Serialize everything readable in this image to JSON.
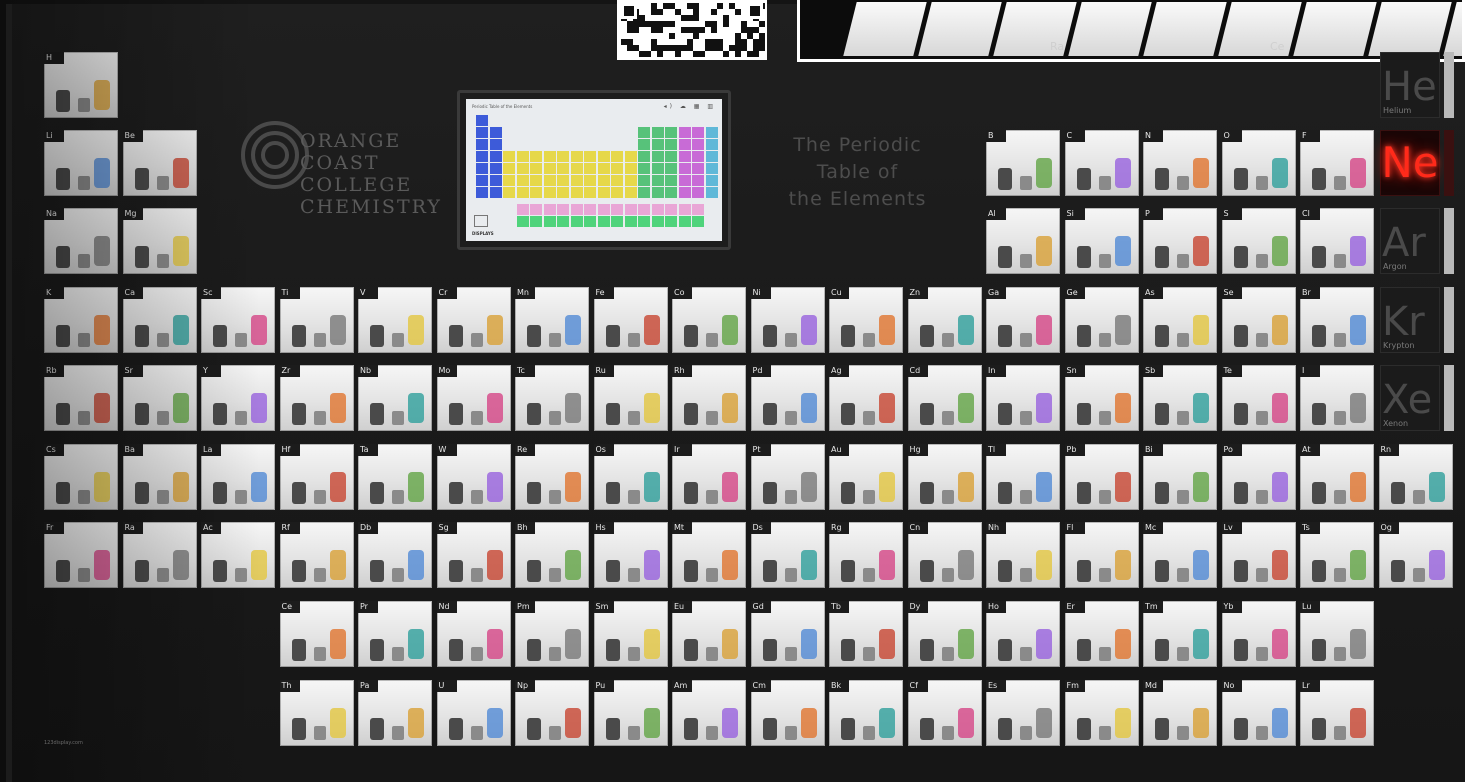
{
  "scene": {
    "college_name": [
      "ORANGE",
      "COAST",
      "COLLEGE",
      "CHEMISTRY"
    ],
    "title": [
      "The Periodic",
      "Table of",
      "the Elements"
    ],
    "monitor_title": "Periodic Table of the Elements",
    "monitor_icons": "◂) ☁ ▦ ▥",
    "monitor_footer": "DISPLAYS",
    "neon": "Ne",
    "watermark": "123display.com"
  },
  "noble_gases": [
    {
      "symbol": "He",
      "name": "Helium"
    },
    {
      "symbol": "Ar",
      "name": "Argon"
    },
    {
      "symbol": "Kr",
      "name": "Krypton"
    },
    {
      "symbol": "Xe",
      "name": "Xenon"
    }
  ],
  "inset_labels": [
    "Ra",
    "Ce"
  ],
  "elements": [
    {
      "s": "H",
      "r": 0,
      "c": 0
    },
    {
      "s": "Li",
      "r": 1,
      "c": 0
    },
    {
      "s": "Be",
      "r": 1,
      "c": 1
    },
    {
      "s": "B",
      "r": 1,
      "c": 12
    },
    {
      "s": "C",
      "r": 1,
      "c": 13
    },
    {
      "s": "N",
      "r": 1,
      "c": 14
    },
    {
      "s": "O",
      "r": 1,
      "c": 15
    },
    {
      "s": "F",
      "r": 1,
      "c": 16
    },
    {
      "s": "Na",
      "r": 2,
      "c": 0
    },
    {
      "s": "Mg",
      "r": 2,
      "c": 1
    },
    {
      "s": "Al",
      "r": 2,
      "c": 12
    },
    {
      "s": "Si",
      "r": 2,
      "c": 13
    },
    {
      "s": "P",
      "r": 2,
      "c": 14
    },
    {
      "s": "S",
      "r": 2,
      "c": 15
    },
    {
      "s": "Cl",
      "r": 2,
      "c": 16
    },
    {
      "s": "K",
      "r": 3,
      "c": 0
    },
    {
      "s": "Ca",
      "r": 3,
      "c": 1
    },
    {
      "s": "Sc",
      "r": 3,
      "c": 2
    },
    {
      "s": "Ti",
      "r": 3,
      "c": 3
    },
    {
      "s": "V",
      "r": 3,
      "c": 4
    },
    {
      "s": "Cr",
      "r": 3,
      "c": 5
    },
    {
      "s": "Mn",
      "r": 3,
      "c": 6
    },
    {
      "s": "Fe",
      "r": 3,
      "c": 7
    },
    {
      "s": "Co",
      "r": 3,
      "c": 8
    },
    {
      "s": "Ni",
      "r": 3,
      "c": 9
    },
    {
      "s": "Cu",
      "r": 3,
      "c": 10
    },
    {
      "s": "Zn",
      "r": 3,
      "c": 11
    },
    {
      "s": "Ga",
      "r": 3,
      "c": 12
    },
    {
      "s": "Ge",
      "r": 3,
      "c": 13
    },
    {
      "s": "As",
      "r": 3,
      "c": 14
    },
    {
      "s": "Se",
      "r": 3,
      "c": 15
    },
    {
      "s": "Br",
      "r": 3,
      "c": 16
    },
    {
      "s": "Rb",
      "r": 4,
      "c": 0
    },
    {
      "s": "Sr",
      "r": 4,
      "c": 1
    },
    {
      "s": "Y",
      "r": 4,
      "c": 2
    },
    {
      "s": "Zr",
      "r": 4,
      "c": 3
    },
    {
      "s": "Nb",
      "r": 4,
      "c": 4
    },
    {
      "s": "Mo",
      "r": 4,
      "c": 5
    },
    {
      "s": "Tc",
      "r": 4,
      "c": 6
    },
    {
      "s": "Ru",
      "r": 4,
      "c": 7
    },
    {
      "s": "Rh",
      "r": 4,
      "c": 8
    },
    {
      "s": "Pd",
      "r": 4,
      "c": 9
    },
    {
      "s": "Ag",
      "r": 4,
      "c": 10
    },
    {
      "s": "Cd",
      "r": 4,
      "c": 11
    },
    {
      "s": "In",
      "r": 4,
      "c": 12
    },
    {
      "s": "Sn",
      "r": 4,
      "c": 13
    },
    {
      "s": "Sb",
      "r": 4,
      "c": 14
    },
    {
      "s": "Te",
      "r": 4,
      "c": 15
    },
    {
      "s": "I",
      "r": 4,
      "c": 16
    },
    {
      "s": "Cs",
      "r": 5,
      "c": 0
    },
    {
      "s": "Ba",
      "r": 5,
      "c": 1
    },
    {
      "s": "La",
      "r": 5,
      "c": 2
    },
    {
      "s": "Hf",
      "r": 5,
      "c": 3
    },
    {
      "s": "Ta",
      "r": 5,
      "c": 4
    },
    {
      "s": "W",
      "r": 5,
      "c": 5
    },
    {
      "s": "Re",
      "r": 5,
      "c": 6
    },
    {
      "s": "Os",
      "r": 5,
      "c": 7
    },
    {
      "s": "Ir",
      "r": 5,
      "c": 8
    },
    {
      "s": "Pt",
      "r": 5,
      "c": 9
    },
    {
      "s": "Au",
      "r": 5,
      "c": 10
    },
    {
      "s": "Hg",
      "r": 5,
      "c": 11
    },
    {
      "s": "Tl",
      "r": 5,
      "c": 12
    },
    {
      "s": "Pb",
      "r": 5,
      "c": 13
    },
    {
      "s": "Bi",
      "r": 5,
      "c": 14
    },
    {
      "s": "Po",
      "r": 5,
      "c": 15
    },
    {
      "s": "At",
      "r": 5,
      "c": 16
    },
    {
      "s": "Rn",
      "r": 5,
      "c": 17
    },
    {
      "s": "Fr",
      "r": 6,
      "c": 0
    },
    {
      "s": "Ra",
      "r": 6,
      "c": 1
    },
    {
      "s": "Ac",
      "r": 6,
      "c": 2
    },
    {
      "s": "Rf",
      "r": 6,
      "c": 3
    },
    {
      "s": "Db",
      "r": 6,
      "c": 4
    },
    {
      "s": "Sg",
      "r": 6,
      "c": 5
    },
    {
      "s": "Bh",
      "r": 6,
      "c": 6
    },
    {
      "s": "Hs",
      "r": 6,
      "c": 7
    },
    {
      "s": "Mt",
      "r": 6,
      "c": 8
    },
    {
      "s": "Ds",
      "r": 6,
      "c": 9
    },
    {
      "s": "Rg",
      "r": 6,
      "c": 10
    },
    {
      "s": "Cn",
      "r": 6,
      "c": 11
    },
    {
      "s": "Nh",
      "r": 6,
      "c": 12
    },
    {
      "s": "Fl",
      "r": 6,
      "c": 13
    },
    {
      "s": "Mc",
      "r": 6,
      "c": 14
    },
    {
      "s": "Lv",
      "r": 6,
      "c": 15
    },
    {
      "s": "Ts",
      "r": 6,
      "c": 16
    },
    {
      "s": "Og",
      "r": 6,
      "c": 17
    },
    {
      "s": "Ce",
      "r": 7,
      "c": 3
    },
    {
      "s": "Pr",
      "r": 7,
      "c": 4
    },
    {
      "s": "Nd",
      "r": 7,
      "c": 5
    },
    {
      "s": "Pm",
      "r": 7,
      "c": 6
    },
    {
      "s": "Sm",
      "r": 7,
      "c": 7
    },
    {
      "s": "Eu",
      "r": 7,
      "c": 8
    },
    {
      "s": "Gd",
      "r": 7,
      "c": 9
    },
    {
      "s": "Tb",
      "r": 7,
      "c": 10
    },
    {
      "s": "Dy",
      "r": 7,
      "c": 11
    },
    {
      "s": "Ho",
      "r": 7,
      "c": 12
    },
    {
      "s": "Er",
      "r": 7,
      "c": 13
    },
    {
      "s": "Tm",
      "r": 7,
      "c": 14
    },
    {
      "s": "Yb",
      "r": 7,
      "c": 15
    },
    {
      "s": "Lu",
      "r": 7,
      "c": 16
    },
    {
      "s": "Th",
      "r": 8,
      "c": 3
    },
    {
      "s": "Pa",
      "r": 8,
      "c": 4
    },
    {
      "s": "U",
      "r": 8,
      "c": 5
    },
    {
      "s": "Np",
      "r": 8,
      "c": 6
    },
    {
      "s": "Pu",
      "r": 8,
      "c": 7
    },
    {
      "s": "Am",
      "r": 8,
      "c": 8
    },
    {
      "s": "Cm",
      "r": 8,
      "c": 9
    },
    {
      "s": "Bk",
      "r": 8,
      "c": 10
    },
    {
      "s": "Cf",
      "r": 8,
      "c": 11
    },
    {
      "s": "Es",
      "r": 8,
      "c": 12
    },
    {
      "s": "Fm",
      "r": 8,
      "c": 13
    },
    {
      "s": "Md",
      "r": 8,
      "c": 14
    },
    {
      "s": "No",
      "r": 8,
      "c": 15
    },
    {
      "s": "Lr",
      "r": 8,
      "c": 16
    }
  ]
}
